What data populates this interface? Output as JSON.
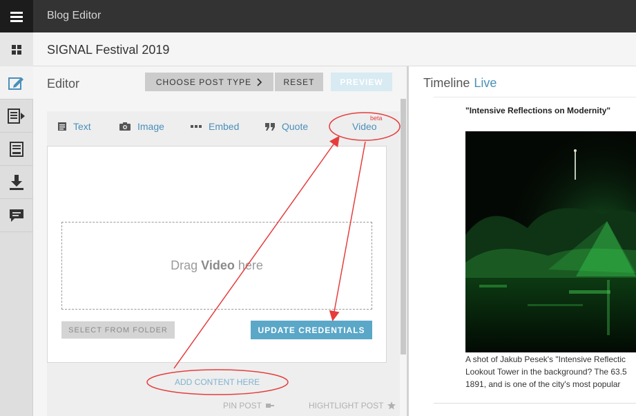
{
  "header": {
    "app_title": "Blog Editor",
    "blog_title": "SIGNAL Festival 2019"
  },
  "rail": {
    "items": [
      "edit-icon",
      "publish-icon",
      "archive-icon",
      "download-icon",
      "comments-icon"
    ]
  },
  "editor": {
    "title": "Editor",
    "choose_post_type": "CHOOSE POST TYPE",
    "reset": "RESET",
    "preview": "PREVIEW",
    "tabs": [
      {
        "label": "Text",
        "icon": "text-icon"
      },
      {
        "label": "Image",
        "icon": "camera-icon"
      },
      {
        "label": "Embed",
        "icon": "embed-icon"
      },
      {
        "label": "Quote",
        "icon": "quote-icon"
      },
      {
        "label": "Video",
        "icon": "video"
      }
    ],
    "beta_badge": "beta",
    "drop_prefix": "Drag",
    "drop_bold": "Video",
    "drop_suffix": "here",
    "select_from_folder": "SELECT FROM FOLDER",
    "update_credentials": "UPDATE CREDENTIALS",
    "add_content": "ADD CONTENT HERE",
    "pin_post": "PIN POST",
    "highlight_post": "HIGHTLIGHT POST"
  },
  "timeline": {
    "title": "Timeline",
    "live": "Live",
    "post": {
      "title": "\"Intensive Reflections on Modernity\"",
      "caption_lines": [
        "A shot of Jakub Pesek's \"Intensive Reflectic",
        "Lookout Tower in the background? The 63.5",
        "1891, and is one of the city's most popular"
      ]
    }
  },
  "colors": {
    "accent": "#4a8fba",
    "annotation": "#e63c3c",
    "update_button": "#5aa7c8"
  }
}
